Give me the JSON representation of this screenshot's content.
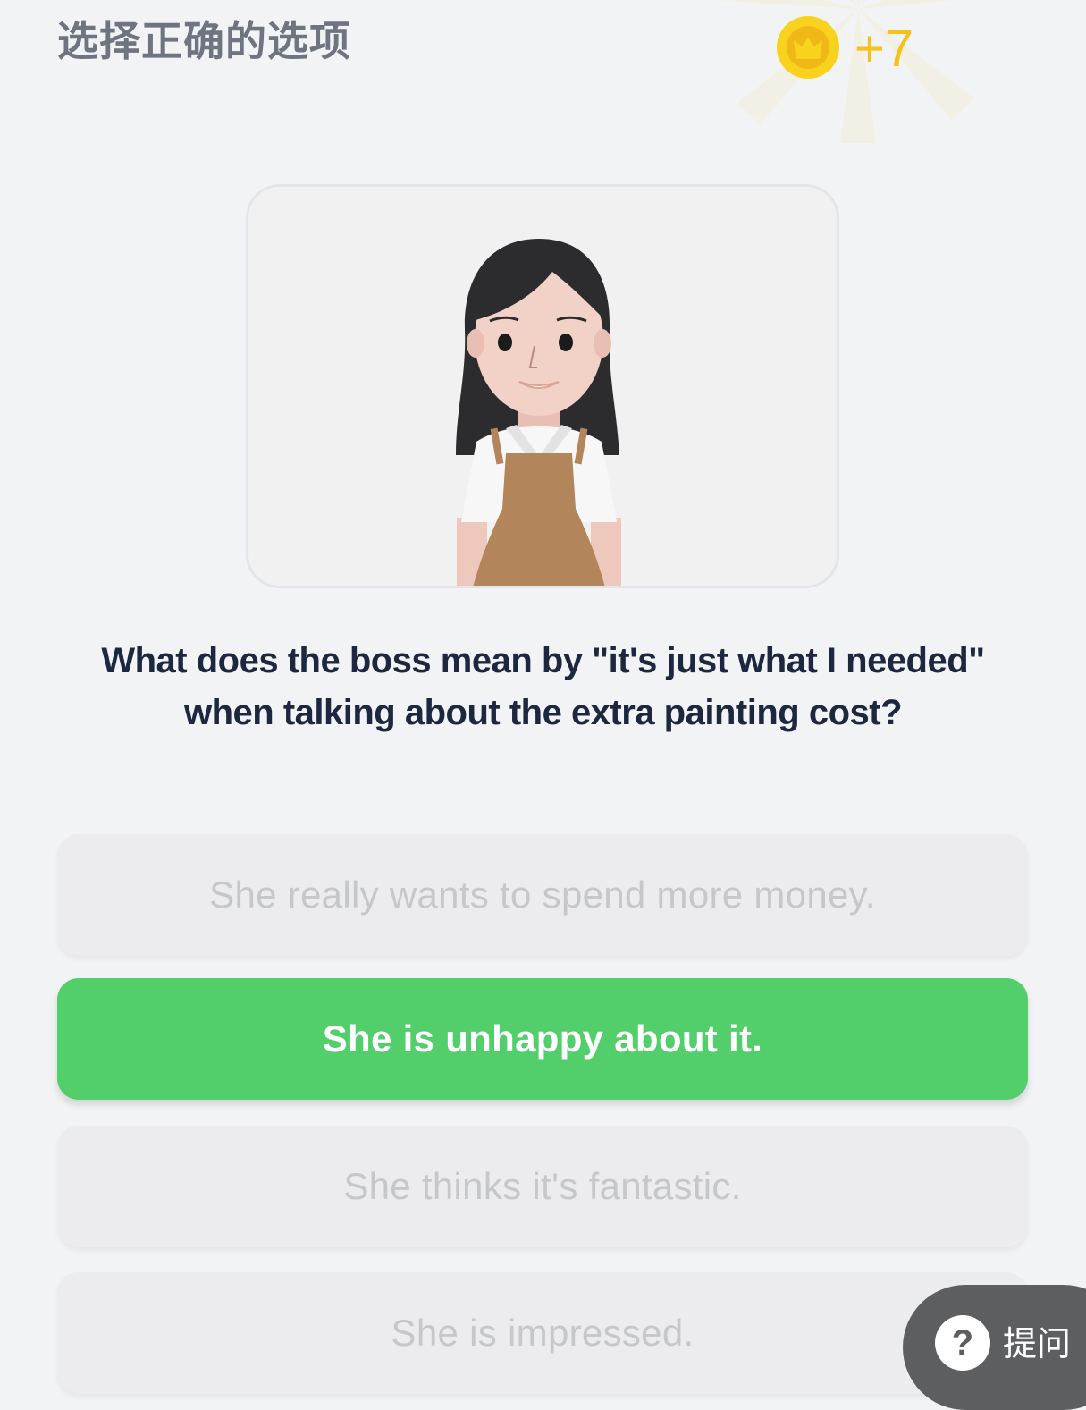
{
  "header": {
    "instruction": "选择正确的选项",
    "reward": "+7",
    "coin_icon": "crown-coin-icon"
  },
  "question": {
    "line1": "What does the boss mean by \"it's just what I needed\"",
    "line2": "when talking about the extra painting cost?"
  },
  "options": [
    {
      "label": "She really wants to spend more money.",
      "selected": false
    },
    {
      "label": "She is unhappy about it.",
      "selected": true
    },
    {
      "label": "She thinks it's fantastic.",
      "selected": false
    },
    {
      "label": "She is impressed.",
      "selected": false
    }
  ],
  "ask_button": {
    "label": "提问",
    "icon": "question-mark-icon"
  },
  "colors": {
    "background": "#f2f3f5",
    "selected_option": "#52ce6a",
    "coin": "#f4c21b",
    "question_text": "#1d2840"
  }
}
